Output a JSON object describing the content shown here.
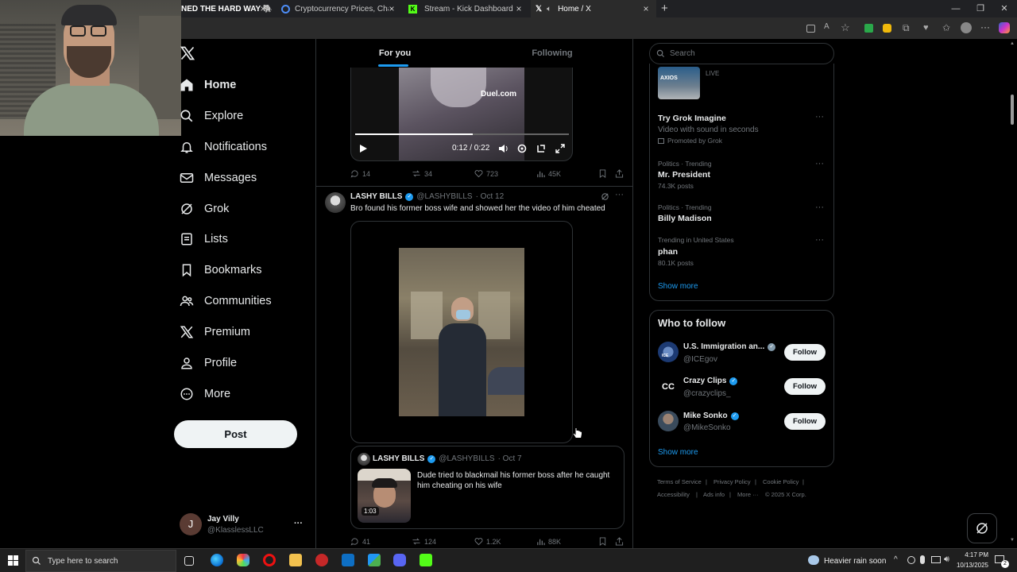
{
  "browser": {
    "tabs": [
      {
        "title": "NED THE HARD WAY 🐘 | A",
        "active": false
      },
      {
        "title": "Cryptocurrency Prices, Charts, Da",
        "active": false
      },
      {
        "title": "Stream - Kick Dashboard",
        "active": false
      },
      {
        "title": "Home / X",
        "active": true
      }
    ],
    "new_tab": "+",
    "controls": [
      "—",
      "❐",
      "✕"
    ]
  },
  "nav": {
    "items": [
      {
        "label": "Home",
        "icon": "home-icon"
      },
      {
        "label": "Explore",
        "icon": "search-icon"
      },
      {
        "label": "Notifications",
        "icon": "bell-icon"
      },
      {
        "label": "Messages",
        "icon": "mail-icon"
      },
      {
        "label": "Grok",
        "icon": "grok-icon"
      },
      {
        "label": "Lists",
        "icon": "list-icon"
      },
      {
        "label": "Bookmarks",
        "icon": "bookmark-icon"
      },
      {
        "label": "Communities",
        "icon": "people-icon"
      },
      {
        "label": "Premium",
        "icon": "x-logo-icon"
      },
      {
        "label": "Profile",
        "icon": "person-icon"
      },
      {
        "label": "More",
        "icon": "more-circle-icon"
      }
    ],
    "post_label": "Post",
    "account": {
      "initial": "J",
      "name": "Jay Villy",
      "handle": "@KlasslessLLC",
      "more": "···"
    }
  },
  "feed": {
    "tabs": [
      {
        "label": "For you",
        "active": true
      },
      {
        "label": "Following",
        "active": false
      }
    ],
    "video1": {
      "watermark": "Duel.com",
      "time": "0:12 / 0:22",
      "progress": 0.55
    },
    "post1_metrics": {
      "replies": "14",
      "reposts": "34",
      "likes": "723",
      "views": "45K"
    },
    "post2": {
      "name": "LASHY BILLS",
      "handle": "@LASHYBILLS",
      "date": "· Oct 12",
      "text": "Bro found his former boss wife and showed her the video of him cheated",
      "quote": {
        "name": "LASHY BILLS",
        "handle": "@LASHYBILLS",
        "date": "· Oct 7",
        "text": "Dude tried to blackmail his  former boss after he caught him cheating on his wife",
        "duration": "1:03"
      },
      "metrics": {
        "replies": "41",
        "reposts": "124",
        "likes": "1.2K",
        "views": "88K"
      }
    }
  },
  "sidebar": {
    "search_placeholder": "Search",
    "live_label": "LIVE",
    "trends": [
      {
        "meta": "",
        "name": "Try Grok Imagine",
        "sub": "Video with sound in seconds",
        "promo": "Promoted by Grok"
      },
      {
        "meta": "Politics · Trending",
        "name": "Mr. President",
        "sub": "74.3K posts"
      },
      {
        "meta": "Politics · Trending",
        "name": "Billy Madison",
        "sub": ""
      },
      {
        "meta": "Trending in United States",
        "name": "phan",
        "sub": "80.1K posts"
      }
    ],
    "show_more": "Show more",
    "who_to_follow": {
      "title": "Who to follow",
      "accounts": [
        {
          "name": "U.S. Immigration an...",
          "handle": "@ICEgov",
          "verified": "gray",
          "btn": "Follow"
        },
        {
          "name": "Crazy Clips",
          "handle": "@crazyclips_",
          "verified": "blue",
          "btn": "Follow"
        },
        {
          "name": "Mike Sonko",
          "handle": "@MikeSonko",
          "verified": "blue",
          "btn": "Follow"
        }
      ],
      "show_more": "Show more"
    },
    "footer": {
      "links": [
        "Terms of Service",
        "Privacy Policy",
        "Cookie Policy",
        "Accessibility",
        "Ads info",
        "More ···"
      ],
      "copyright": "© 2025 X Corp."
    }
  },
  "taskbar": {
    "search_placeholder": "Type here to search",
    "weather": "Heavier rain soon",
    "time": "4:17 PM",
    "date": "10/13/2025",
    "notif_count": "2"
  },
  "colors": {
    "accent": "#1d9bf0",
    "bg": "#000000",
    "border": "#2f3336",
    "muted": "#71767b"
  }
}
